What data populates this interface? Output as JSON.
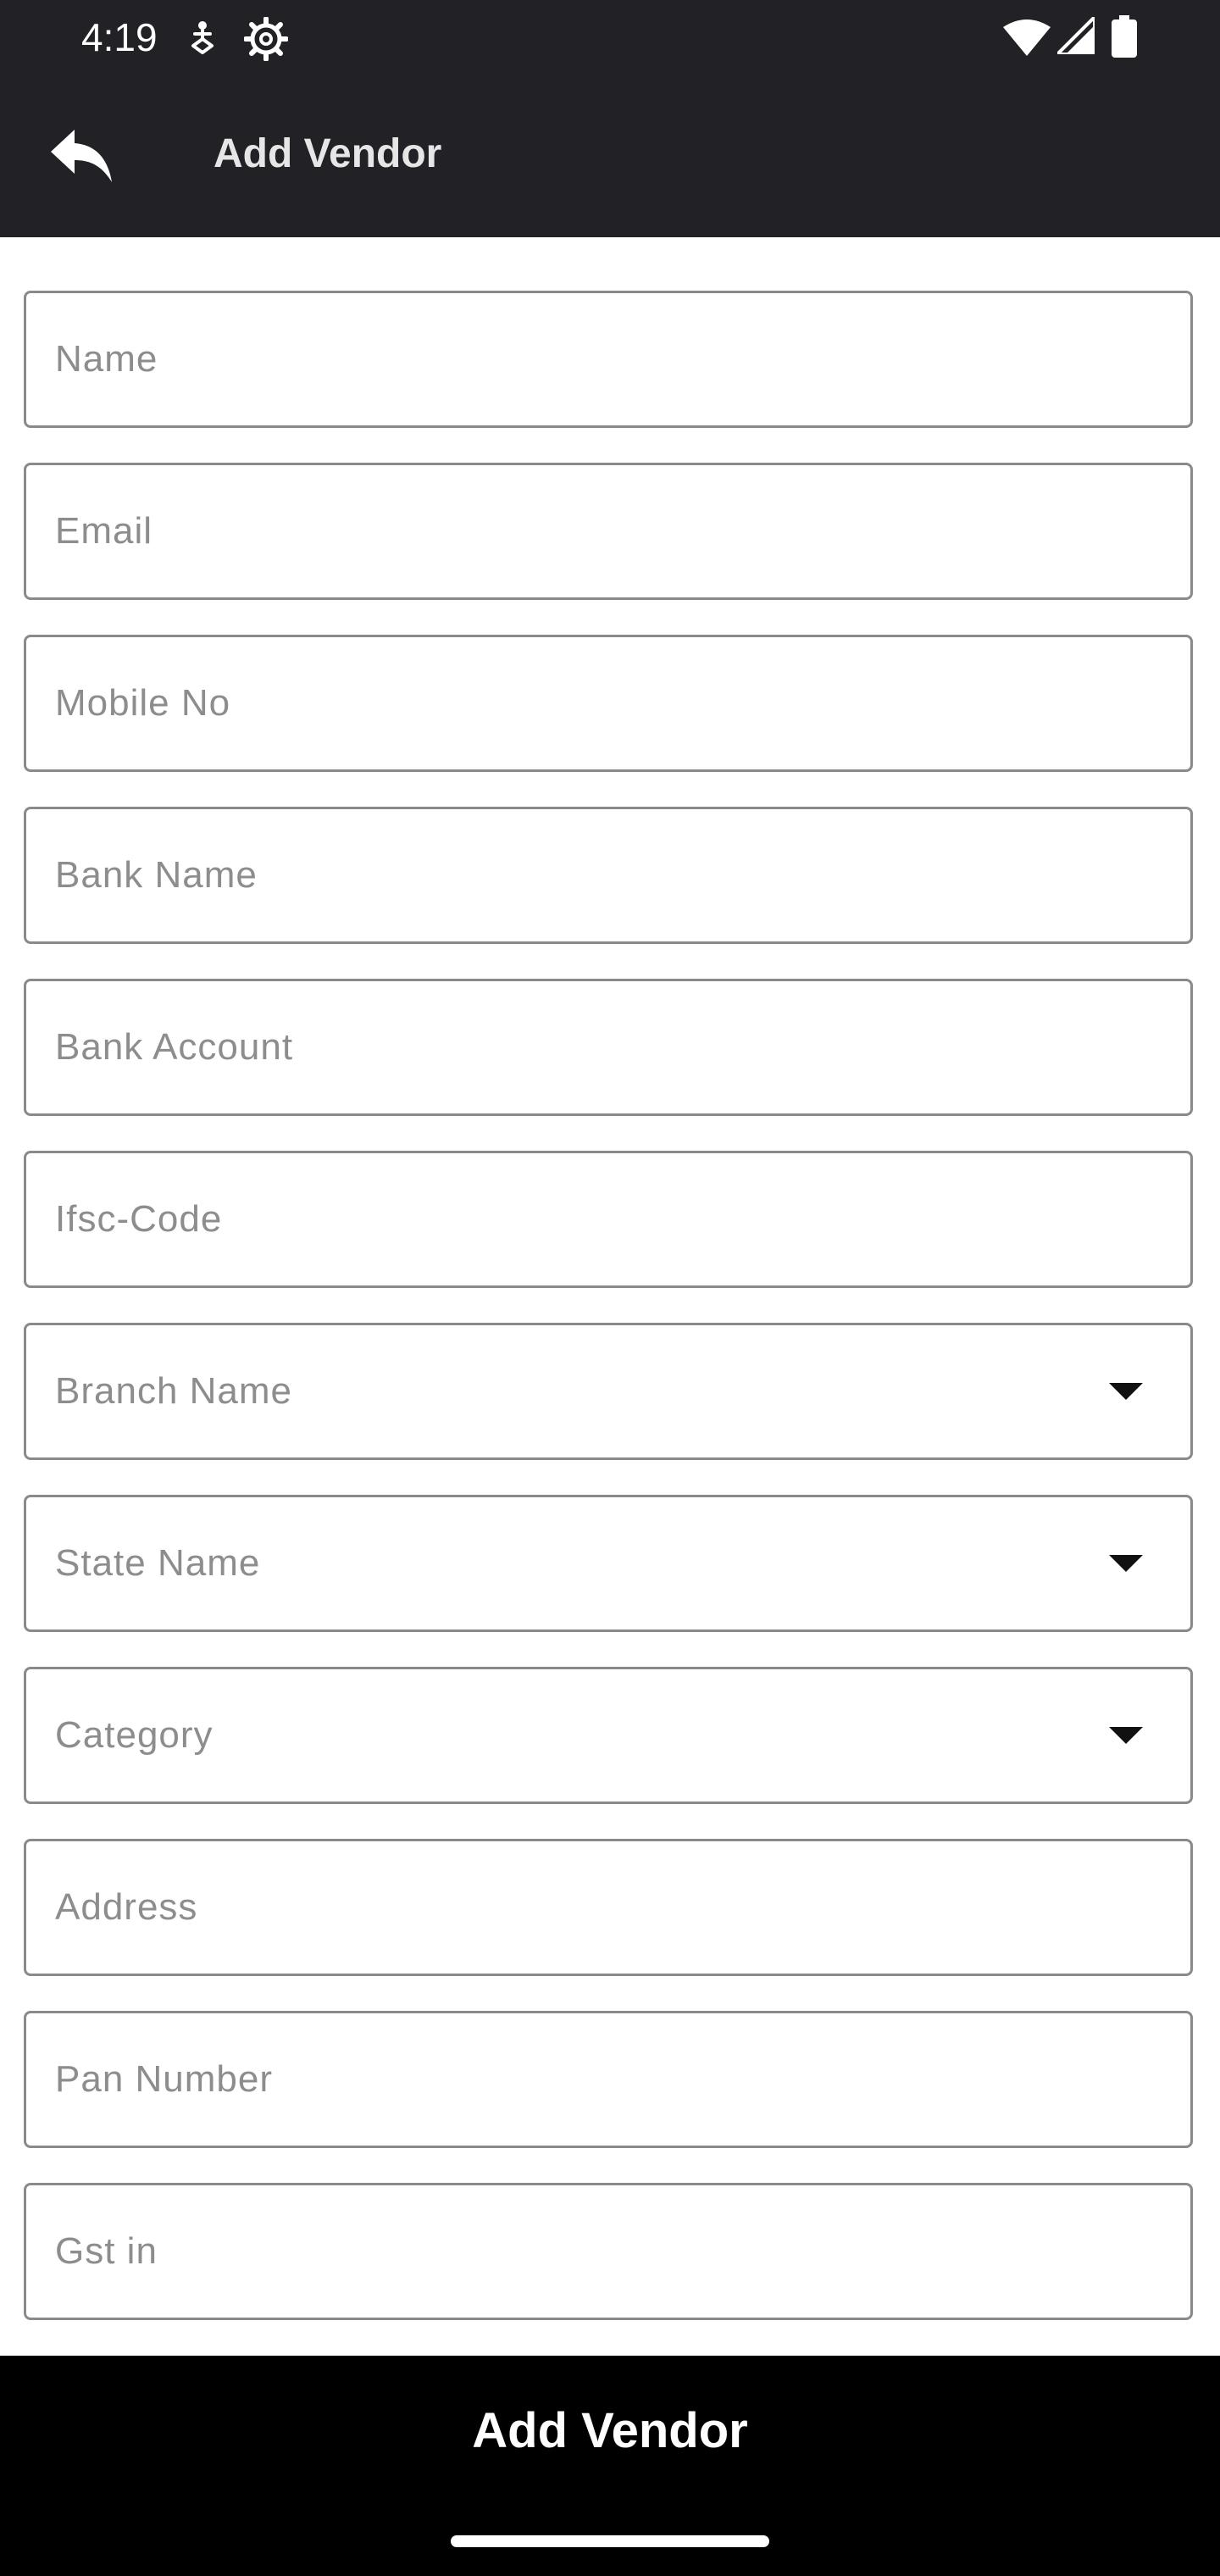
{
  "status_bar": {
    "time": "4:19",
    "icons_left": [
      "accessibility-icon",
      "settings-gear-icon"
    ],
    "icons_right": [
      "wifi-icon",
      "cellular-signal-icon",
      "battery-icon"
    ]
  },
  "app_bar": {
    "back_icon": "reply-arrow-icon",
    "title": "Add Vendor"
  },
  "form": {
    "fields": [
      {
        "label": "Name",
        "type": "text",
        "value": ""
      },
      {
        "label": "Email",
        "type": "text",
        "value": ""
      },
      {
        "label": "Mobile No",
        "type": "text",
        "value": ""
      },
      {
        "label": "Bank Name",
        "type": "text",
        "value": ""
      },
      {
        "label": "Bank Account",
        "type": "text",
        "value": ""
      },
      {
        "label": "Ifsc-Code",
        "type": "text",
        "value": ""
      },
      {
        "label": "Branch Name",
        "type": "dropdown",
        "value": ""
      },
      {
        "label": "State Name",
        "type": "dropdown",
        "value": ""
      },
      {
        "label": "Category",
        "type": "dropdown",
        "value": ""
      },
      {
        "label": "Address",
        "type": "text",
        "value": ""
      },
      {
        "label": "Pan Number",
        "type": "text",
        "value": ""
      },
      {
        "label": "Gst in",
        "type": "text",
        "value": ""
      }
    ]
  },
  "submit": {
    "label": "Add Vendor"
  },
  "colors": {
    "header_bg": "#222226",
    "bottom_bg": "#000000",
    "field_border": "#8a8a8a",
    "placeholder_text": "#8d8d8d"
  }
}
